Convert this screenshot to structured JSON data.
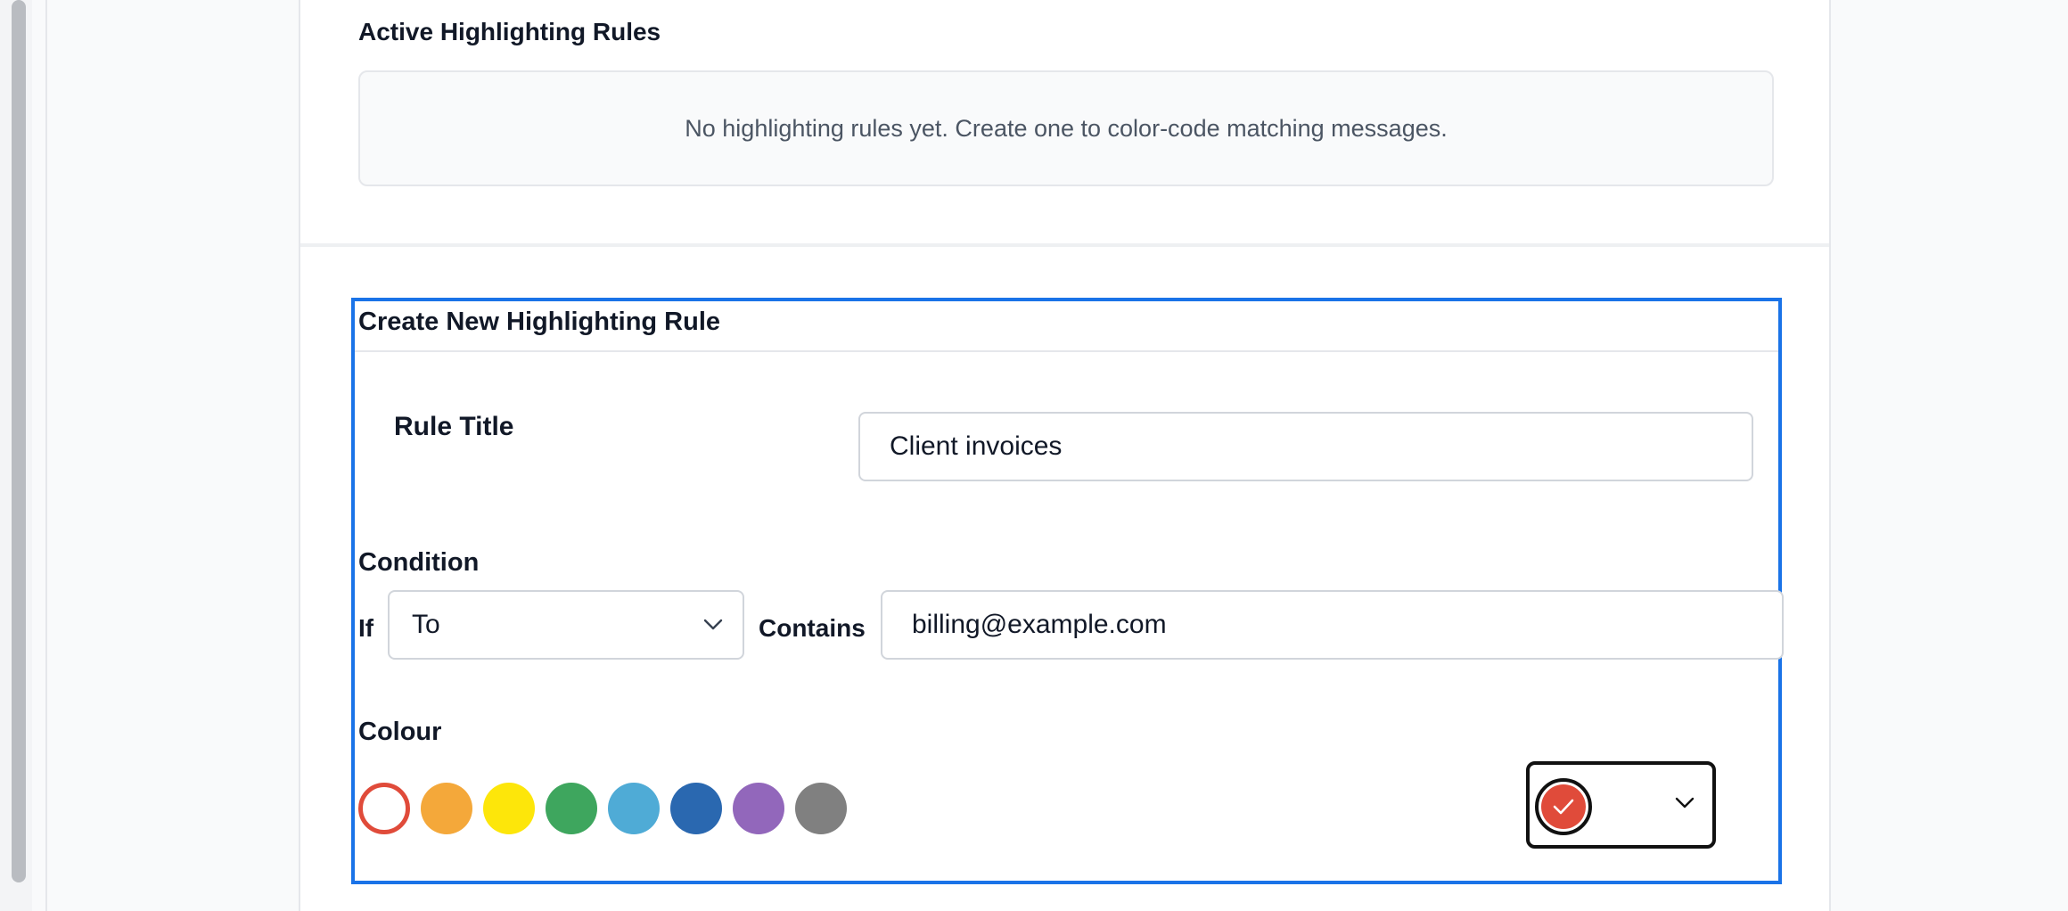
{
  "active_rules": {
    "title": "Active Highlighting Rules",
    "empty_message": "No highlighting rules yet. Create one to color-code matching messages."
  },
  "create_rule": {
    "title": "Create New Highlighting Rule",
    "rule_title_label": "Rule Title",
    "rule_title_value": "Client invoices",
    "condition_label": "Condition",
    "if_label": "If",
    "field_select_value": "To",
    "contains_label": "Contains",
    "contains_value": "billing@example.com",
    "colour_label": "Colour"
  },
  "colours": {
    "selected": "#e04b3a",
    "swatches": [
      "#e04b3a",
      "#f4a83a",
      "#fde60a",
      "#3ea65e",
      "#4fabd6",
      "#2a68b0",
      "#9267bb",
      "#808080"
    ]
  },
  "icons": {
    "chevron": "chevron-down-icon",
    "check": "check-icon"
  },
  "accent_color": "#1a73e8"
}
